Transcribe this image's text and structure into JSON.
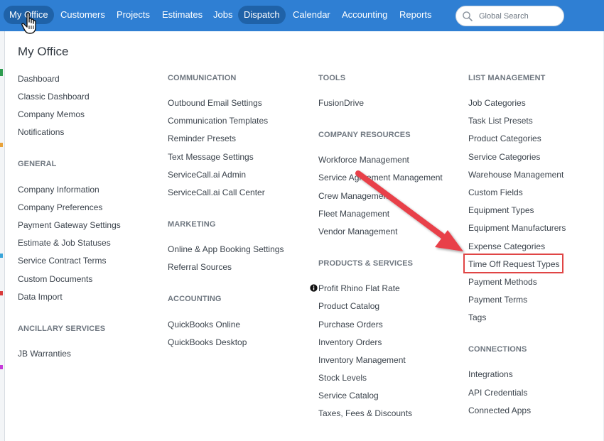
{
  "nav": {
    "items": [
      "My Office",
      "Customers",
      "Projects",
      "Estimates",
      "Jobs",
      "Dispatch",
      "Calendar",
      "Accounting",
      "Reports"
    ],
    "active": "My Office",
    "search_placeholder": "Global Search"
  },
  "panel": {
    "title": "My Office",
    "columns": [
      {
        "sections": [
          {
            "title": "",
            "links": [
              "Dashboard",
              "Classic Dashboard",
              "Company Memos",
              "Notifications"
            ]
          },
          {
            "title": "GENERAL",
            "links": [
              "Company Information",
              "Company Preferences",
              "Payment Gateway Settings",
              "Estimate & Job Statuses",
              "Service Contract Terms",
              "Custom Documents",
              "Data Import"
            ]
          },
          {
            "title": "ANCILLARY SERVICES",
            "links": [
              "JB Warranties"
            ]
          }
        ]
      },
      {
        "sections": [
          {
            "title": "COMMUNICATION",
            "links": [
              "Outbound Email Settings",
              "Communication Templates",
              "Reminder Presets",
              "Text Message Settings",
              "ServiceCall.ai Admin",
              "ServiceCall.ai Call Center"
            ]
          },
          {
            "title": "MARKETING",
            "links": [
              "Online & App Booking Settings",
              "Referral Sources"
            ]
          },
          {
            "title": "ACCOUNTING",
            "links": [
              "QuickBooks Online",
              "QuickBooks Desktop"
            ]
          }
        ]
      },
      {
        "sections": [
          {
            "title": "TOOLS",
            "links": [
              "FusionDrive"
            ]
          },
          {
            "title": "COMPANY RESOURCES",
            "links": [
              "Workforce Management",
              "Service Agreement Management",
              "Crew Management",
              "Fleet Management",
              "Vendor Management"
            ]
          },
          {
            "title": "PRODUCTS & SERVICES",
            "links": [
              "Profit Rhino Flat Rate",
              "Product Catalog",
              "Purchase Orders",
              "Inventory Orders",
              "Inventory Management",
              "Stock Levels",
              "Service Catalog",
              "Taxes, Fees & Discounts"
            ]
          }
        ]
      },
      {
        "sections": [
          {
            "title": "LIST MANAGEMENT",
            "links": [
              "Job Categories",
              "Task List Presets",
              "Product Categories",
              "Service Categories",
              "Warehouse Management",
              "Custom Fields",
              "Equipment Types",
              "Equipment Manufacturers",
              "Expense Categories",
              "Time Off Request Types",
              "Payment Methods",
              "Payment Terms",
              "Tags"
            ]
          },
          {
            "title": "CONNECTIONS",
            "links": [
              "Integrations",
              "API Credentials",
              "Connected Apps"
            ]
          }
        ]
      }
    ],
    "highlighted_link": "Time Off Request Types"
  },
  "colors": {
    "nav_bg": "#2f7fd3",
    "nav_active": "#1f62a8",
    "highlight": "#e04545",
    "arrow": "#e8404a"
  },
  "icons": [
    "search-icon",
    "info-icon",
    "hand-cursor-icon",
    "arrow-icon"
  ]
}
